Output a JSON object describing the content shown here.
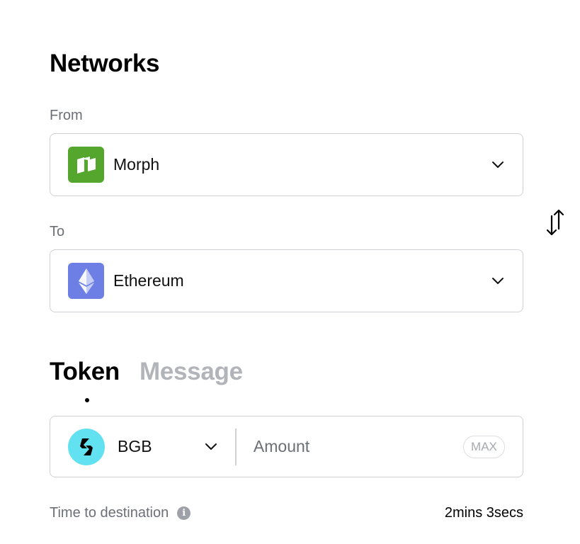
{
  "networks": {
    "title": "Networks",
    "from": {
      "label": "From",
      "network": "Morph",
      "icon": "morph-logo-icon",
      "icon_color": "#54a62d"
    },
    "to": {
      "label": "To",
      "network": "Ethereum",
      "icon": "ethereum-logo-icon",
      "icon_color": "#6d7fe5"
    },
    "swap_icon": "swap-arrows-icon"
  },
  "tabs": [
    {
      "label": "Token",
      "active": true
    },
    {
      "label": "Message",
      "active": false
    }
  ],
  "token": {
    "symbol": "BGB",
    "icon": "bgb-logo-icon",
    "icon_color": "#62e2f0",
    "amount_placeholder": "Amount",
    "amount_value": "",
    "max_label": "MAX"
  },
  "time": {
    "label": "Time to destination",
    "value": "2mins 3secs",
    "info_icon": "info-icon"
  }
}
